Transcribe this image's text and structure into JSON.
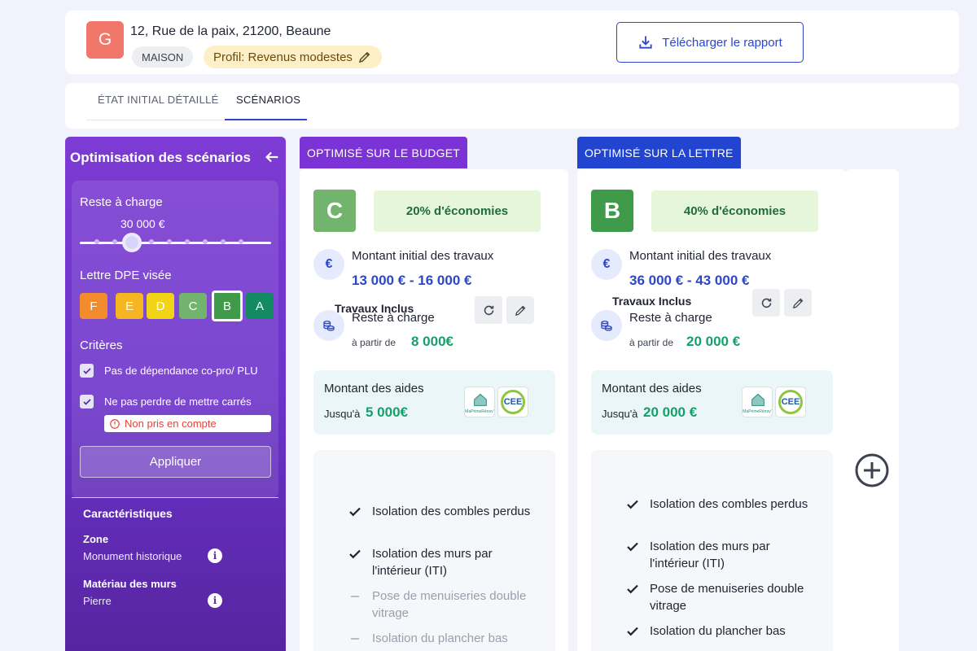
{
  "header": {
    "avatar_letter": "G",
    "address": "12, Rue de la paix, 21200, Beaune",
    "type_chip": "MAISON",
    "profile_chip": "Profil: Revenus modestes",
    "download_label": "Télécharger le rapport"
  },
  "tabs": [
    {
      "label": "ÉTAT INITIAL DÉTAILLÉ",
      "active": false
    },
    {
      "label": "SCÉNARIOS",
      "active": true
    }
  ],
  "sidebar": {
    "title": "Optimisation des scénarios",
    "reste_label": "Reste à charge",
    "reste_value": "30 000 €",
    "slider_level": 0.27,
    "dpe_label": "Lettre DPE visée",
    "dpe_letters": [
      {
        "letter": "F",
        "color": "#f28b2c"
      },
      {
        "letter": "E",
        "color": "#f5b622"
      },
      {
        "letter": "D",
        "color": "#f2d417"
      },
      {
        "letter": "C",
        "color": "#72b36e"
      },
      {
        "letter": "B",
        "color": "#3f9b4a",
        "selected": true
      },
      {
        "letter": "A",
        "color": "#148a62"
      }
    ],
    "criteria_label": "Critères",
    "criteria": [
      {
        "label": "Pas de dépendance co-pro/ PLU",
        "checked": true
      },
      {
        "label": "Ne pas perdre de mettre carrés",
        "checked": true
      }
    ],
    "warning": "Non pris en compte",
    "apply_label": "Appliquer",
    "characteristics_title": "Caractéristiques",
    "characteristics": [
      {
        "key": "Zone",
        "value": "Monument historique"
      },
      {
        "key": "Matériau des murs",
        "value": "Pierre"
      }
    ]
  },
  "scenarios": [
    {
      "tag": "OPTIMISÉ SUR LE BUDGET",
      "tag_color": "#7b33d6",
      "grade": "C",
      "grade_color": "#72b36e",
      "savings": "20% d'économies",
      "initial_label": "Montant initial des travaux",
      "initial_value": "13 000 € - 16 000 €",
      "reste_label": "Reste à charge",
      "from_label": "à partir de",
      "reste_value": "8 000€",
      "aid_label": "Montant des aides",
      "aid_from": "Jusqu'à",
      "aid_value": "5 000€",
      "works_title": "Travaux Inclus",
      "works": [
        {
          "label": "Isolation des combles perdus",
          "included": true
        },
        {
          "label": "Isolation des murs par l'intérieur (ITI)",
          "included": true
        },
        {
          "label": "Pose de menuiseries double vitrage",
          "included": false
        },
        {
          "label": "Isolation du plancher bas",
          "included": false
        }
      ]
    },
    {
      "tag": "OPTIMISÉ SUR LA LETTRE",
      "tag_color": "#2145d1",
      "grade": "B",
      "grade_color": "#3f9b4a",
      "savings": "40% d'économies",
      "initial_label": "Montant initial des travaux",
      "initial_value": "36 000 € - 43 000 €",
      "reste_label": "Reste à charge",
      "from_label": "à partir de",
      "reste_value": "20 000 €",
      "aid_label": "Montant des aides",
      "aid_from": "Jusqu'à",
      "aid_value": "20 000 €",
      "works_title": "Travaux Inclus",
      "works": [
        {
          "label": "Isolation des combles perdus",
          "included": true
        },
        {
          "label": "Isolation des murs par l'intérieur (ITI)",
          "included": true
        },
        {
          "label": "Pose de menuiseries double vitrage",
          "included": true
        },
        {
          "label": "Isolation du plancher bas",
          "included": true
        }
      ]
    }
  ],
  "logos": {
    "mpr": "MaPrimeRénov'",
    "cee": "CEE"
  }
}
